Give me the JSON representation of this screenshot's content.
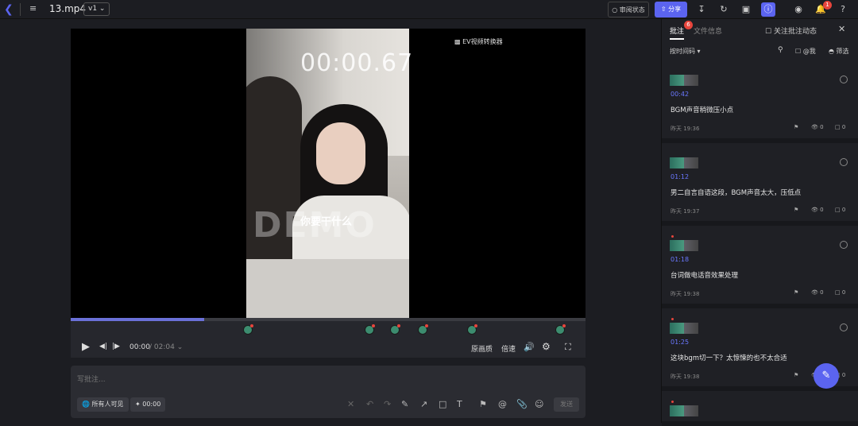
{
  "topbar": {
    "back_icon": "chevron-left-icon",
    "list_icon": "list-icon",
    "file_title": "13.mp4",
    "version": "v1 ⌄",
    "review_status": "○ 审阅状态",
    "share_label": "分享",
    "notification_count": "1",
    "help_icon": "?"
  },
  "video": {
    "timer_overlay": "00:00.67",
    "watermark": "EV视频转换器",
    "demo_text": "DEMO",
    "subtitle": "你要干什么",
    "progress_fraction": 0.26
  },
  "controls": {
    "current_time": "00:00",
    "total_time": " / 02:04 ⌄",
    "quality": "原画质",
    "speed": "倍速"
  },
  "comment_box": {
    "placeholder": "写批注...",
    "visibility": "所有人可见",
    "timestamp": "00:00",
    "send": "发送"
  },
  "panel": {
    "tab_comments": "批注",
    "tab_comments_count": "6",
    "tab_fileinfo": "文件信息",
    "follow_label": "关注批注动态",
    "sort_label": "按时间码 ▾",
    "at_me": "@我",
    "filter": "筛选",
    "comments": [
      {
        "time": "00:42",
        "text": "BGM声音稍微压小点",
        "date": "昨天 19:36",
        "views": "0",
        "replies": "0"
      },
      {
        "time": "01:12",
        "text": "男二自言自语这段，BGM声音太大，压低点",
        "date": "昨天 19:37",
        "views": "0",
        "replies": "0"
      },
      {
        "time": "01:18",
        "text": "台词做电话音效果处理",
        "date": "昨天 19:38",
        "views": "0",
        "replies": "0"
      },
      {
        "time": "01:25",
        "text": "这块bgm切一下？太惊悚的也不太合适",
        "date": "昨天 19:38",
        "views": "0",
        "replies": "0"
      }
    ]
  }
}
